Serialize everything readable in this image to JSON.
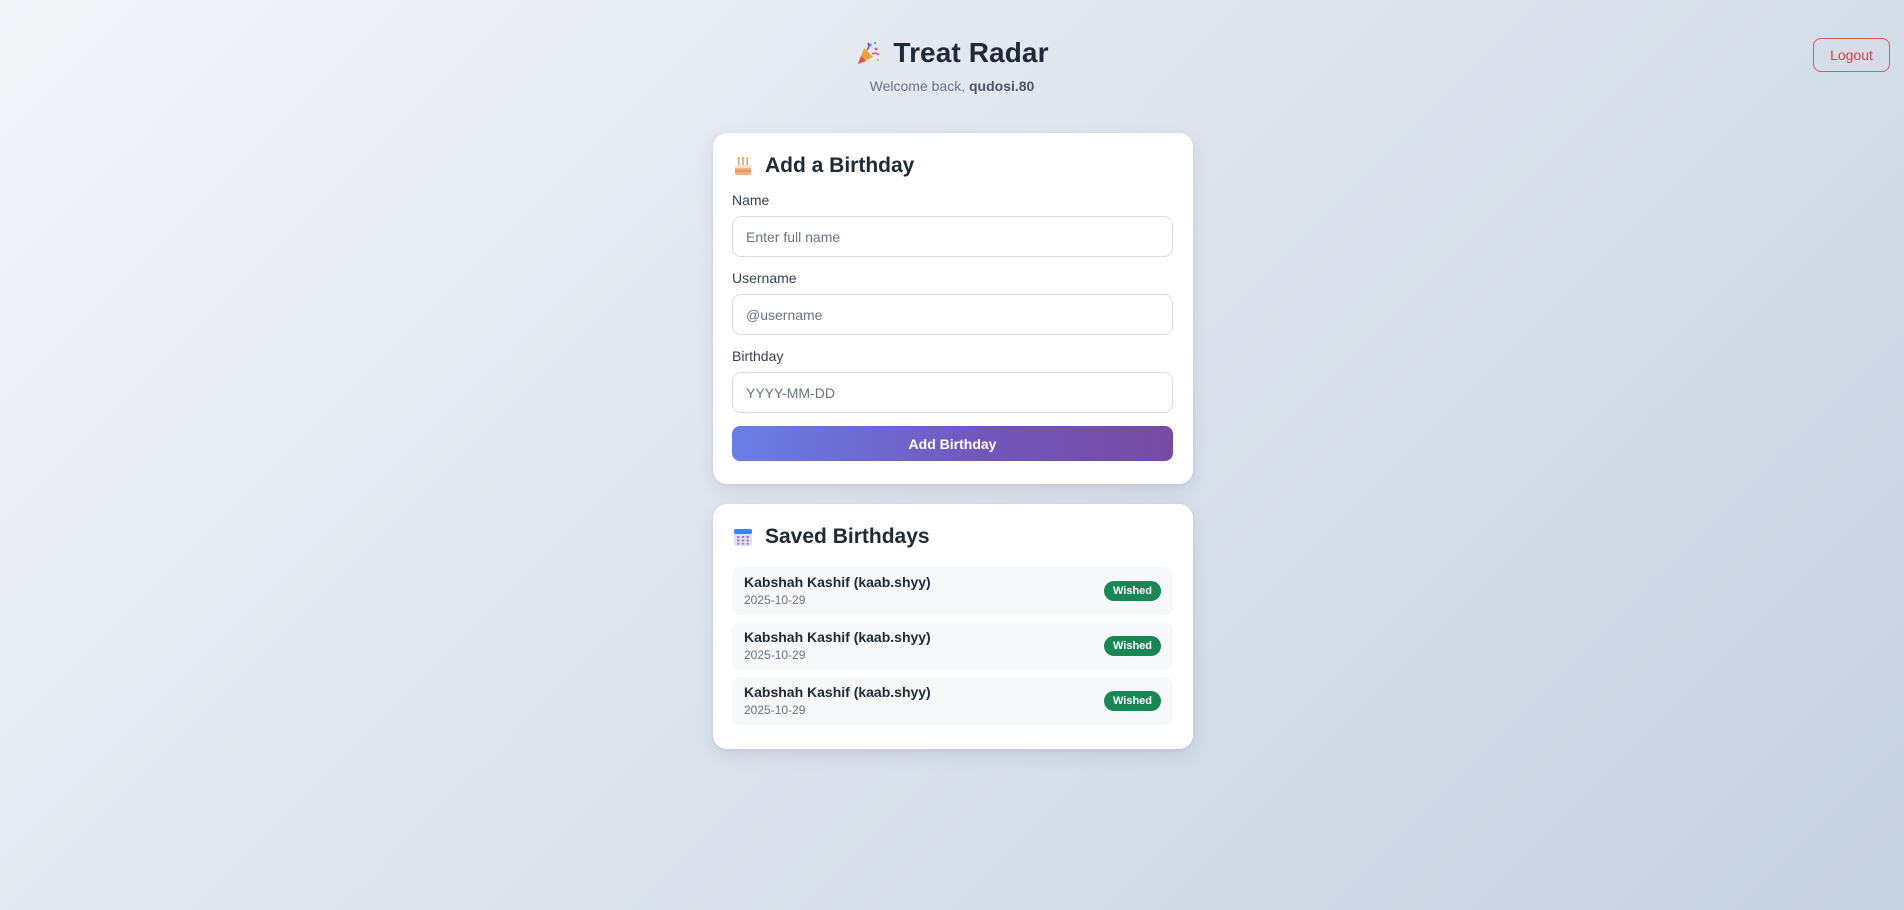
{
  "header": {
    "icon": "party-popper-icon",
    "title": "Treat Radar",
    "welcome_prefix": "Welcome back, ",
    "username": "qudosi.80",
    "logout_label": "Logout"
  },
  "add_card": {
    "icon": "birthday-cake-icon",
    "title": "Add a Birthday",
    "fields": [
      {
        "label": "Name",
        "placeholder": "Enter full name",
        "value": ""
      },
      {
        "label": "Username",
        "placeholder": "@username",
        "value": ""
      },
      {
        "label": "Birthday",
        "placeholder": "YYYY-MM-DD",
        "value": ""
      }
    ],
    "submit_label": "Add Birthday"
  },
  "saved_card": {
    "icon": "calendar-icon",
    "title": "Saved Birthdays",
    "items": [
      {
        "name": "Kabshah Kashif (kaab.shyy)",
        "date": "2025-10-29",
        "status": "Wished"
      },
      {
        "name": "Kabshah Kashif (kaab.shyy)",
        "date": "2025-10-29",
        "status": "Wished"
      },
      {
        "name": "Kabshah Kashif (kaab.shyy)",
        "date": "2025-10-29",
        "status": "Wished"
      }
    ]
  },
  "colors": {
    "accent_gradient_start": "#667eea",
    "accent_gradient_end": "#764ba2",
    "logout": "#dc3d43",
    "badge_success": "#198754"
  }
}
